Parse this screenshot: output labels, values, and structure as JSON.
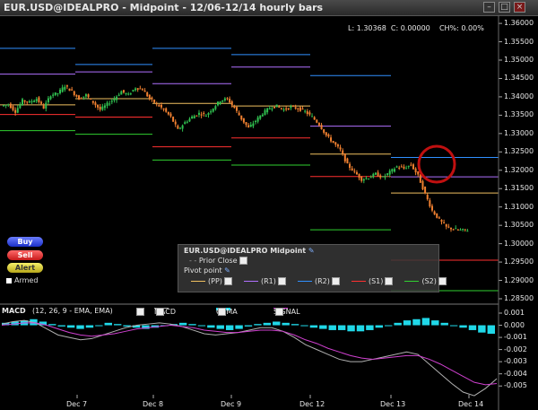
{
  "window": {
    "title": "EUR.USD@IDEALPRO - Midpoint - 12/06-12/14  hourly bars",
    "btn_min": "–",
    "btn_max": "□",
    "btn_close": "×"
  },
  "readout": "L: 1.30368  C: 0.00000    CH%: 0.00%",
  "price_axis": [
    "1.36000",
    "1.35500",
    "1.35000",
    "1.34500",
    "1.34000",
    "1.33500",
    "1.33000",
    "1.32500",
    "1.32000",
    "1.31500",
    "1.31000",
    "1.30500",
    "1.30000",
    "1.29500",
    "1.29000",
    "1.28500"
  ],
  "macd_axis": [
    "0.001",
    "0.000",
    "-0.001",
    "-0.002",
    "-0.003",
    "-0.004",
    "-0.005"
  ],
  "date_labels": [
    "Dec 7",
    "Dec 8",
    "Dec 9",
    "Dec 12",
    "Dec 13",
    "Dec 14"
  ],
  "buttons": {
    "buy": "Buy",
    "sell": "Sell",
    "alert": "Alert",
    "armed": "Armed"
  },
  "legend": {
    "title": "EUR.USD@IDEALPRO Midpoint",
    "prior_close": "Prior Close",
    "pivot": "Pivot point",
    "pp": "(PP)",
    "r1": "(R1)",
    "r2": "(R2)",
    "s1": "(S1)",
    "s2": "(S2)"
  },
  "macd_bar": {
    "title": "MACD",
    "params": "(12, 26, 9 - EMA, EMA)",
    "macd": "MACD",
    "osma": "OSMA",
    "signal": "SIGNAL"
  },
  "colors": {
    "pp": "#f0c060",
    "r1": "#b070ff",
    "r2": "#3090ff",
    "s1": "#ff3030",
    "s2": "#30d030",
    "up": "#30c050",
    "down": "#f08030",
    "osma": "#20d8e8",
    "macd_line": "#b0b0b0",
    "signal_line": "#d040d0",
    "highlight": "#c01010"
  },
  "chart_data": {
    "type": "candlestick",
    "ylim": [
      1.285,
      1.361
    ],
    "pivot_levels": [
      {
        "day": "Dec 7",
        "pp": 1.3378,
        "r1": 1.3462,
        "r2": 1.3532,
        "s1": 1.3352,
        "s2": 1.3308
      },
      {
        "day": "Dec 8",
        "pp": 1.3395,
        "r1": 1.3468,
        "r2": 1.3488,
        "s1": 1.3345,
        "s2": 1.3298
      },
      {
        "day": "Dec 9",
        "pp": 1.3382,
        "r1": 1.3436,
        "r2": 1.3532,
        "s1": 1.3264,
        "s2": 1.3228
      },
      {
        "day": "Dec 12",
        "pp": 1.3375,
        "r1": 1.3481,
        "r2": 1.3515,
        "s1": 1.3288,
        "s2": 1.3214
      },
      {
        "day": "Dec 13",
        "pp": 1.3244,
        "r1": 1.332,
        "r2": 1.3458,
        "s1": 1.3183,
        "s2": 1.3038
      },
      {
        "day": "Dec 14",
        "pp": 1.3138,
        "r1": 1.3182,
        "r2": 1.3235,
        "s1": 1.2955,
        "s2": 1.2872
      }
    ],
    "close_path": [
      1.3375,
      1.338,
      1.336,
      1.339,
      1.3385,
      1.3395,
      1.337,
      1.3405,
      1.341,
      1.343,
      1.3415,
      1.3395,
      1.3405,
      1.3385,
      1.3365,
      1.338,
      1.3395,
      1.3415,
      1.3405,
      1.3425,
      1.342,
      1.3395,
      1.338,
      1.3365,
      1.3345,
      1.331,
      1.333,
      1.3345,
      1.3355,
      1.335,
      1.337,
      1.339,
      1.3395,
      1.337,
      1.334,
      1.3315,
      1.3335,
      1.3355,
      1.337,
      1.3375,
      1.3365,
      1.3372,
      1.3368,
      1.336,
      1.3345,
      1.3325,
      1.3295,
      1.3275,
      1.3255,
      1.3215,
      1.3195,
      1.3175,
      1.318,
      1.319,
      1.318,
      1.3195,
      1.321,
      1.3205,
      1.3215,
      1.3185,
      1.3135,
      1.309,
      1.3065,
      1.3045,
      1.304,
      1.3037,
      1.3037
    ],
    "macd_osma": [
      0.0002,
      0.0003,
      0.0004,
      0.0005,
      0.0003,
      0.0001,
      -0.0001,
      -0.0002,
      -0.0003,
      -0.0002,
      0,
      0.0002,
      0.0001,
      -0.0001,
      -0.0002,
      -0.0003,
      -0.0002,
      0,
      0.0001,
      0.0002,
      0.0001,
      0,
      -0.0002,
      -0.0003,
      -0.0004,
      -0.0003,
      -0.0001,
      0.0001,
      0.0002,
      0.0003,
      0.0002,
      0.0001,
      0,
      -0.0002,
      -0.0003,
      -0.0004,
      -0.0004,
      -0.0005,
      -0.0005,
      -0.0004,
      -0.0002,
      0,
      0.0002,
      0.0004,
      0.0005,
      0.0006,
      0.0004,
      0.0002,
      0,
      -0.0002,
      -0.0004,
      -0.0006,
      -0.0007
    ],
    "macd_line": [
      0.0001,
      0.0003,
      0.0004,
      0.0002,
      -0.0003,
      -0.0008,
      -0.001,
      -0.0012,
      -0.0011,
      -0.0008,
      -0.0005,
      -0.0002,
      0,
      0.0001,
      0.0002,
      0.0001,
      -0.0001,
      -0.0004,
      -0.0007,
      -0.0008,
      -0.0007,
      -0.0006,
      -0.0004,
      -0.0002,
      -0.0002,
      -0.0005,
      -0.001,
      -0.0016,
      -0.002,
      -0.0024,
      -0.0028,
      -0.003,
      -0.003,
      -0.0028,
      -0.0026,
      -0.0024,
      -0.0022,
      -0.0024,
      -0.0032,
      -0.004,
      -0.0048,
      -0.0055,
      -0.0058,
      -0.0052,
      -0.0044
    ],
    "signal_line": [
      0,
      0.0001,
      0.0002,
      0.0002,
      0,
      -0.0003,
      -0.0006,
      -0.0008,
      -0.0009,
      -0.0008,
      -0.0007,
      -0.0005,
      -0.0003,
      -0.0002,
      -0.0001,
      0,
      -0.0001,
      -0.0002,
      -0.0004,
      -0.0005,
      -0.0006,
      -0.0006,
      -0.0005,
      -0.0004,
      -0.0004,
      -0.0005,
      -0.0008,
      -0.0012,
      -0.0015,
      -0.0019,
      -0.0022,
      -0.0025,
      -0.0027,
      -0.0028,
      -0.0027,
      -0.0026,
      -0.0025,
      -0.0025,
      -0.0028,
      -0.0032,
      -0.0037,
      -0.0042,
      -0.0047,
      -0.0049,
      -0.0048
    ],
    "highlight_at": "Dec 13, 1.3195"
  }
}
